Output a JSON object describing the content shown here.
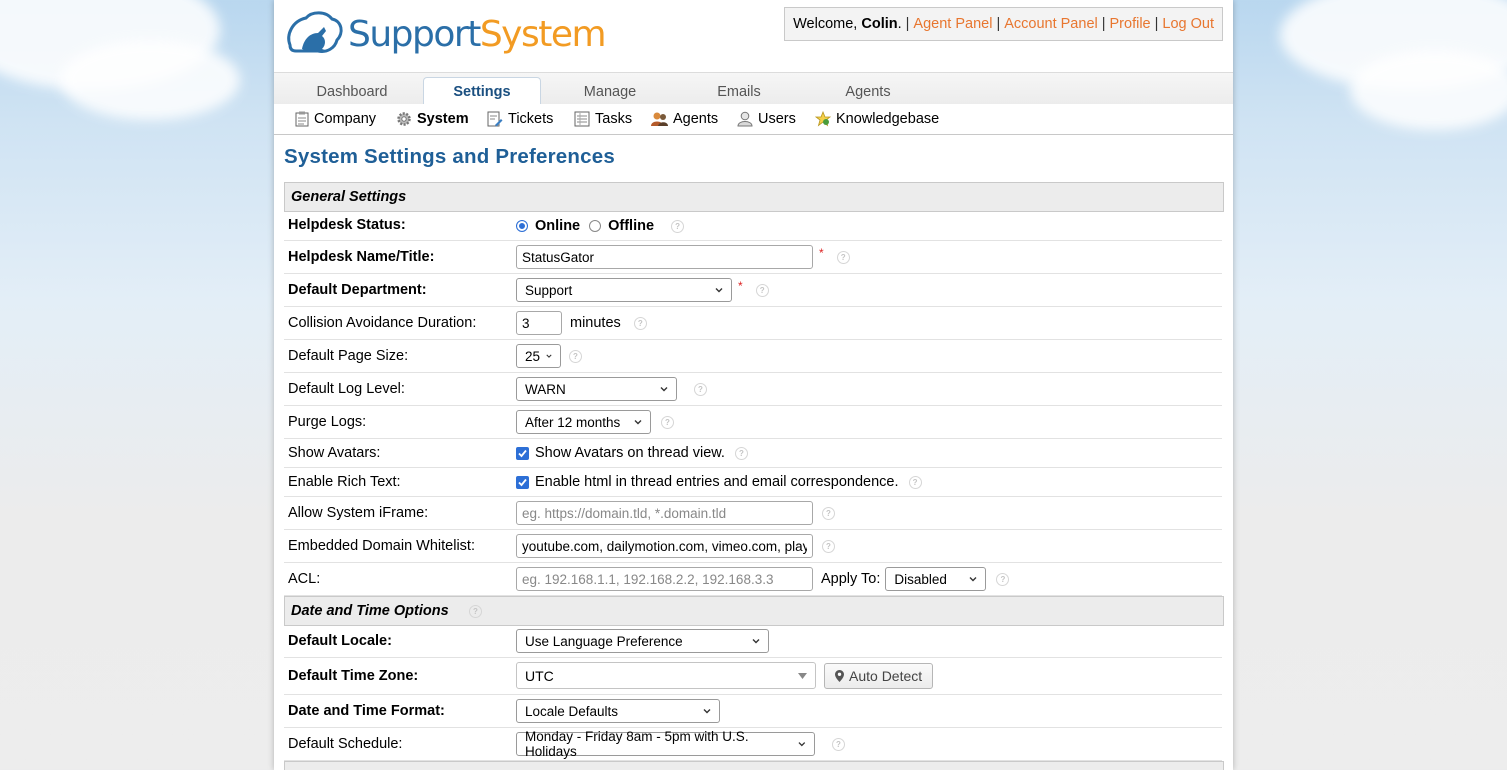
{
  "brand": {
    "part1": "Support",
    "part2": "System"
  },
  "user": {
    "welcome_prefix": "Welcome, ",
    "name": "Colin",
    "welcome_suffix": ".",
    "links": [
      "Agent Panel",
      "Account Panel",
      "Profile",
      "Log Out"
    ]
  },
  "nav": {
    "tabs": [
      "Dashboard",
      "Settings",
      "Manage",
      "Emails",
      "Agents"
    ],
    "active_tab": "Settings"
  },
  "subnav": {
    "items": [
      "Company",
      "System",
      "Tickets",
      "Tasks",
      "Agents",
      "Users",
      "Knowledgebase"
    ],
    "active": "System"
  },
  "page_title": "System Settings and Preferences",
  "general": {
    "section_title": "General Settings",
    "helpdesk_status": {
      "label": "Helpdesk Status:",
      "online": "Online",
      "offline": "Offline",
      "selected": "Online"
    },
    "helpdesk_name": {
      "label": "Helpdesk Name/Title:",
      "value": "StatusGator",
      "required": "*"
    },
    "default_department": {
      "label": "Default Department:",
      "value": "Support",
      "required": "*"
    },
    "collision": {
      "label": "Collision Avoidance Duration:",
      "value": "3",
      "unit": "minutes"
    },
    "page_size": {
      "label": "Default Page Size:",
      "value": "25"
    },
    "log_level": {
      "label": "Default Log Level:",
      "value": "WARN"
    },
    "purge_logs": {
      "label": "Purge Logs:",
      "value": "After 12 months"
    },
    "show_avatars": {
      "label": "Show Avatars:",
      "text": "Show Avatars on thread view.",
      "checked": true
    },
    "rich_text": {
      "label": "Enable Rich Text:",
      "text": "Enable html in thread entries and email correspondence.",
      "checked": true
    },
    "iframe": {
      "label": "Allow System iFrame:",
      "placeholder": "eg. https://domain.tld, *.domain.tld",
      "value": ""
    },
    "whitelist": {
      "label": "Embedded Domain Whitelist:",
      "value": "youtube.com, dailymotion.com, vimeo.com, play"
    },
    "acl": {
      "label": "ACL:",
      "placeholder": "eg. 192.168.1.1, 192.168.2.2, 192.168.3.3",
      "apply_label": "Apply To:",
      "apply_value": "Disabled"
    }
  },
  "datetime": {
    "section_title": "Date and Time Options",
    "locale": {
      "label": "Default Locale:",
      "value": "Use Language Preference"
    },
    "timezone": {
      "label": "Default Time Zone:",
      "value": "UTC",
      "detect": "Auto Detect"
    },
    "format": {
      "label": "Date and Time Format:",
      "value": "Locale Defaults"
    },
    "schedule": {
      "label": "Default Schedule:",
      "value": "Monday - Friday 8am - 5pm with U.S. Holidays"
    }
  },
  "colors": {
    "link": "#e8762f",
    "title": "#1f5f97",
    "brand_blue": "#2b6fa8",
    "brand_orange": "#f29b23"
  },
  "help_glyph": "?"
}
